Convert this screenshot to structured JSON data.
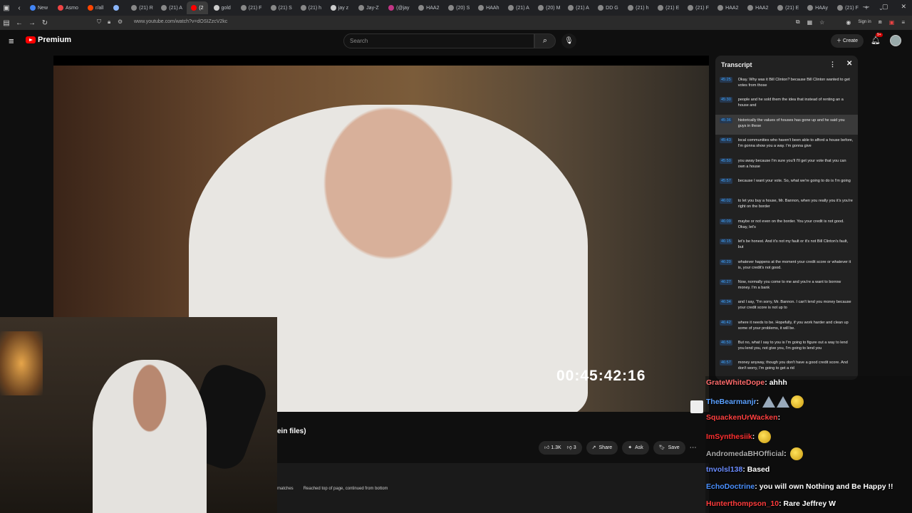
{
  "browser": {
    "tabs": [
      {
        "label": "New",
        "color": "#4285f4"
      },
      {
        "label": "Asmo",
        "color": "#e44"
      },
      {
        "label": "r/all",
        "color": "#ff4500"
      },
      {
        "label": "",
        "color": "#8ab4f8"
      },
      {
        "label": "(21) R",
        "color": "#888"
      },
      {
        "label": "(21) A",
        "color": "#888"
      },
      {
        "label": "(2",
        "color": "#f00",
        "active": true
      },
      {
        "label": "gold",
        "color": "#ccc"
      },
      {
        "label": "(21) F",
        "color": "#888"
      },
      {
        "label": "(21) S",
        "color": "#888"
      },
      {
        "label": "(21) h",
        "color": "#888"
      },
      {
        "label": "jay z",
        "color": "#ccc"
      },
      {
        "label": "Jay-Z",
        "color": "#888"
      },
      {
        "label": "(@jay",
        "color": "#c13584"
      },
      {
        "label": "HAA2",
        "color": "#888"
      },
      {
        "label": "(20) S",
        "color": "#888"
      },
      {
        "label": "HAAh",
        "color": "#888"
      },
      {
        "label": "(21) A",
        "color": "#888"
      },
      {
        "label": "(20) M",
        "color": "#888"
      },
      {
        "label": "(21) A",
        "color": "#888"
      },
      {
        "label": "DD G",
        "color": "#888"
      },
      {
        "label": "(21) h",
        "color": "#888"
      },
      {
        "label": "(21) E",
        "color": "#888"
      },
      {
        "label": "(21) F",
        "color": "#888"
      },
      {
        "label": "HAA2",
        "color": "#888"
      },
      {
        "label": "HAA2",
        "color": "#888"
      },
      {
        "label": "(21) E",
        "color": "#888"
      },
      {
        "label": "HAAy",
        "color": "#888"
      },
      {
        "label": "(21) F",
        "color": "#888"
      }
    ],
    "url": "www.youtube.com/watch?v=dOSIZzcV2kc",
    "signin": "Sign in"
  },
  "youtube": {
    "logo_text": "Premium",
    "search_placeholder": "Search",
    "create_label": "Create",
    "notif_badge": "9+"
  },
  "video": {
    "timecode": "00:45:42:16",
    "title_fragment": "ein files)",
    "like_count": "1.3K",
    "dislike_count": "3",
    "share_label": "Share",
    "ask_label": "Ask",
    "save_label": "Save"
  },
  "findbar": {
    "matches": "matches",
    "message": "Reached top of page, continued from bottom"
  },
  "transcript": {
    "title": "Transcript",
    "segments": [
      {
        "time": "45:25",
        "text": "Okay. Why was it Bill Clinton? because Bill Clinton wanted to get votes from those"
      },
      {
        "time": "45:30",
        "text": "people and he sold them the idea that instead of renting an a house and"
      },
      {
        "time": "45:36",
        "text": "historically the values of houses has gone up and he said you guys in these",
        "highlight": true
      },
      {
        "time": "45:43",
        "text": "local communities who haven't been able to afford a house before, I'm gonna show you a way. I'm gonna give"
      },
      {
        "time": "45:50",
        "text": "you away because I'm sure you'll I'll get your vote that you can own a house"
      },
      {
        "time": "45:57",
        "text": "because I want your vote. So, what we're going to do is I'm going"
      },
      {
        "time": "46:02",
        "text": "to let you buy a house, Mr. Bannon, when you really you it's you're right on the border"
      },
      {
        "time": "46:09",
        "text": "maybe or not even on the border. You your credit is not good. Okay, let's"
      },
      {
        "time": "46:15",
        "text": "let's be honest. And it's not my fault or it's not Bill Clinton's fault, but"
      },
      {
        "time": "46:20",
        "text": "whatever happens at the moment your credit score or whatever it is, your credit's not good."
      },
      {
        "time": "46:27",
        "text": "Now, normally you come to me and you're a want to borrow money. I'm a bank"
      },
      {
        "time": "46:34",
        "text": "and I say, \"I'm sorry, Mr. Bannon. I can't lend you money because your credit score is not up to"
      },
      {
        "time": "46:42",
        "text": "where it needs to be. Hopefully, if you work harder and clean up some of your problems, it will be."
      },
      {
        "time": "46:50",
        "text": "But no, what I say to you is I'm going to figure out a way to lend you lend you, not give you, I'm going to lend you"
      },
      {
        "time": "46:57",
        "text": "money anyway, though you don't have a good credit score. And don't worry, I'm going to get a rid"
      }
    ]
  },
  "chat": {
    "messages": [
      {
        "user": "GrateWhiteDope",
        "color": "#ff6b6b",
        "text": "ahhh",
        "emotes": []
      },
      {
        "user": "TheBearmanjr",
        "color": "#5aa0ff",
        "text": "",
        "emotes": [
          "tri",
          "tri",
          "face"
        ]
      },
      {
        "user": "SquackenUrWacken",
        "color": "#ff4040",
        "text": "",
        "emotes": []
      },
      {
        "user": "ImSynthesiik",
        "color": "#ff3030",
        "text": "",
        "emotes": [
          "face"
        ]
      },
      {
        "user": "AndromedaBHOfficial",
        "color": "#aaaaaa",
        "text": "",
        "emotes": [
          "face"
        ]
      },
      {
        "user": "tnvolsl138",
        "color": "#6a8cff",
        "text": "Based",
        "emotes": []
      },
      {
        "user": "EchoDoctrine",
        "color": "#4a90ff",
        "text": "you will own Nothing and Be Happy !!",
        "emotes": []
      },
      {
        "user": "Hunterthompson_10",
        "color": "#ff3c3c",
        "text": "Rare Jeffrey W",
        "emotes": []
      }
    ]
  }
}
